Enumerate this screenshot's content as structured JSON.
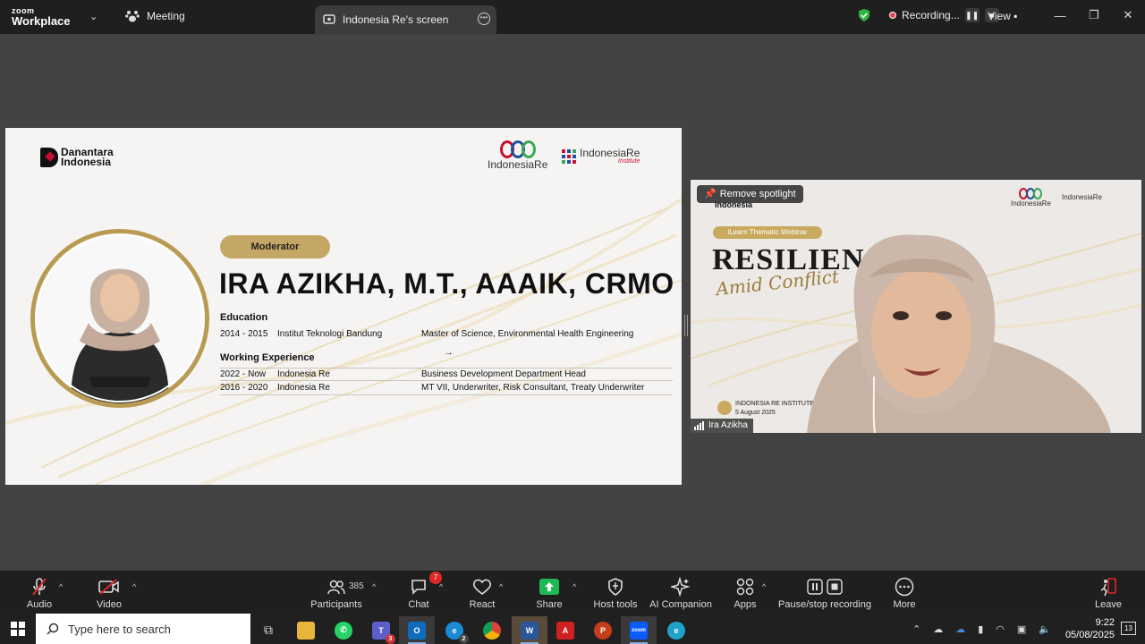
{
  "titlebar": {
    "logo_line1": "zoom",
    "logo_line2": "Workplace",
    "meeting_label": "Meeting",
    "screen_tab_label": "Indonesia Re's screen",
    "recording_label": "Recording...",
    "view_label": "View"
  },
  "slide": {
    "danantara_line1": "Danantara",
    "danantara_line2": "Indonesia",
    "ire_logo": "IndonesiaRe",
    "inst_logo_main": "IndonesiaRe",
    "inst_logo_sub": "Institute",
    "role_pill": "Moderator",
    "name": "IRA AZIKHA, M.T., AAAIK, CRMO",
    "education_heading": "Education",
    "education": [
      {
        "years": "2014 - 2015",
        "place": "Institut Teknologi Bandung",
        "detail": "Master of Science, Environmental Health Engineering"
      }
    ],
    "work_heading": "Working Experience",
    "work": [
      {
        "years": "2022 - Now",
        "place": "Indonesia Re",
        "detail": "Business Development Department Head"
      },
      {
        "years": "2016 - 2020",
        "place": "Indonesia Re",
        "detail": "MT VII, Underwriter, Risk Consultant, Treaty Underwriter"
      }
    ]
  },
  "video": {
    "spotlight_button": "Remove spotlight",
    "bg_indonesia": "Indonesia",
    "bg_ire": "IndonesiaRe",
    "bg_inst": "IndonesiaRe",
    "bg_pill": "iLearn Thematic Webinar",
    "bg_title": "RESILIENC",
    "bg_subtitle": "Amid Conflict",
    "bg_footer_line1": "INDONESIA RE INSTITUTE",
    "bg_footer_line2": "5 August 2025",
    "participant_name": "Ira Azikha"
  },
  "toolbar": {
    "audio": "Audio",
    "video": "Video",
    "participants": "Participants",
    "participants_count": "385",
    "chat": "Chat",
    "chat_badge": "7",
    "react": "React",
    "share": "Share",
    "host_tools": "Host tools",
    "ai_companion": "AI Companion",
    "apps": "Apps",
    "pause_stop": "Pause/stop recording",
    "more": "More",
    "leave": "Leave"
  },
  "taskbar": {
    "search_placeholder": "Type here to search",
    "teams_badge": "3",
    "edge_badge": "2",
    "time": "9:22",
    "date": "05/08/2025",
    "notifications": "13"
  },
  "colors": {
    "gold": "#c5a765",
    "zoom_dark": "#1f1f1f",
    "recording_red": "#e8474e",
    "share_green": "#1db954"
  }
}
